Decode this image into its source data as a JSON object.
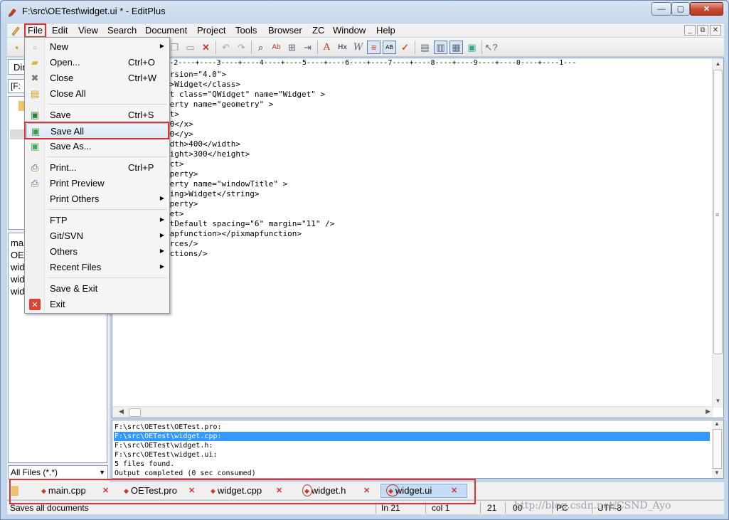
{
  "window": {
    "title": "F:\\src\\OETest\\widget.ui * - EditPlus",
    "min": "—",
    "max": "▢",
    "close": "✕"
  },
  "menubar": {
    "items": [
      "File",
      "Edit",
      "View",
      "Search",
      "Document",
      "Project",
      "Tools",
      "Browser",
      "ZC",
      "Window",
      "Help"
    ],
    "mdi": [
      "_",
      "⧉",
      "✕"
    ]
  },
  "file_menu": {
    "items": [
      {
        "label": "New",
        "shortcut": "",
        "submenu": true,
        "icon": "new-document-icon"
      },
      {
        "label": "Open...",
        "shortcut": "Ctrl+O",
        "submenu": false,
        "icon": "open-folder-icon"
      },
      {
        "label": "Close",
        "shortcut": "Ctrl+W",
        "submenu": false,
        "icon": "close-x-icon"
      },
      {
        "label": "Close All",
        "shortcut": "",
        "submenu": false,
        "icon": "close-all-icon"
      },
      {
        "label": "Save",
        "shortcut": "Ctrl+S",
        "submenu": false,
        "icon": "save-disk-icon"
      },
      {
        "label": "Save All",
        "shortcut": "",
        "submenu": false,
        "icon": "save-all-icon"
      },
      {
        "label": "Save As...",
        "shortcut": "",
        "submenu": false,
        "icon": "save-as-icon"
      },
      {
        "label": "Print...",
        "shortcut": "Ctrl+P",
        "submenu": false,
        "icon": "printer-icon"
      },
      {
        "label": "Print Preview",
        "shortcut": "",
        "submenu": false,
        "icon": "print-preview-icon"
      },
      {
        "label": "Print Others",
        "shortcut": "",
        "submenu": true,
        "icon": ""
      },
      {
        "label": "FTP",
        "shortcut": "",
        "submenu": true,
        "icon": ""
      },
      {
        "label": "Git/SVN",
        "shortcut": "",
        "submenu": true,
        "icon": ""
      },
      {
        "label": "Others",
        "shortcut": "",
        "submenu": true,
        "icon": ""
      },
      {
        "label": "Recent Files",
        "shortcut": "",
        "submenu": true,
        "icon": ""
      },
      {
        "label": "Save & Exit",
        "shortcut": "",
        "submenu": false,
        "icon": ""
      },
      {
        "label": "Exit",
        "shortcut": "",
        "submenu": false,
        "icon": "exit-icon"
      }
    ],
    "highlighted": "Save All"
  },
  "left_pane": {
    "tab_partial": "Dir",
    "drive_partial": "[F:",
    "files_partial": [
      "ma",
      "OE",
      "wid",
      "wid",
      "widg"
    ],
    "filter": "All Files (*.*)"
  },
  "editor": {
    "ruler": "----1----+----2----+----3----+----4----+----5----+----6----+----7----+----8----+----9----+----0----+----1---",
    "lines": [
      "ersion=\"4.0\">",
      "s>Widget</class>",
      "et class=\"QWidget\" name=\"Widget\" >",
      "perty name=\"geometry\" >",
      "ct>",
      ">0</x>",
      ">0</y>",
      "idth>400</width>",
      "eight>300</height>",
      "ect>",
      "operty>",
      "perty name=\"windowTitle\" >",
      "ring>Widget</string>",
      "operty>",
      "get>",
      "utDefault spacing=\"6\" margin=\"11\" />",
      "mapfunction></pixmapfunction>",
      "urces/>",
      "ections/>"
    ]
  },
  "output": {
    "lines": [
      "F:\\src\\OETest\\OETest.pro:",
      "F:\\src\\OETest\\widget.cpp:",
      "F:\\src\\OETest\\widget.h:",
      "F:\\src\\OETest\\widget.ui:",
      "5 files found.",
      "Output completed (0 sec consumed)"
    ],
    "selected_index": 1
  },
  "tabs": [
    {
      "label": "main.cpp",
      "active": false
    },
    {
      "label": "OETest.pro",
      "active": false
    },
    {
      "label": "widget.cpp",
      "active": false
    },
    {
      "label": "widget.h",
      "active": false
    },
    {
      "label": "widget.ui",
      "active": true
    }
  ],
  "status": {
    "message": "Saves all documents",
    "line": "In 21",
    "col": "col 1",
    "count": "21",
    "zeros": "00",
    "mode": "PC",
    "encoding": "UTF-8",
    "watermark": "http://blog.csdn.net/CSND_Ayo"
  },
  "colors": {
    "highlight_box": "#e53030",
    "selection": "#3399ff"
  }
}
